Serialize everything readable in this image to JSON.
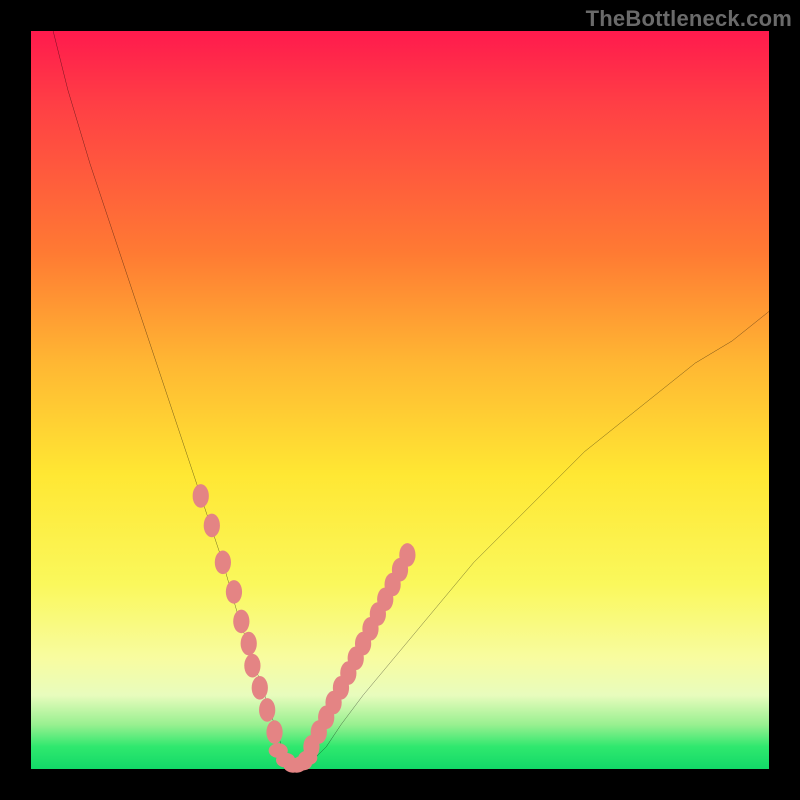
{
  "watermark": "TheBottleneck.com",
  "chart_data": {
    "type": "line",
    "title": "",
    "xlabel": "",
    "ylabel": "",
    "xlim": [
      0,
      100
    ],
    "ylim": [
      0,
      100
    ],
    "grid": false,
    "series": [
      {
        "name": "bottleneck-curve",
        "x": [
          3,
          5,
          8,
          11,
          14,
          17,
          20,
          23,
          26,
          28,
          30,
          32,
          33,
          34,
          35,
          36,
          38,
          40,
          42,
          45,
          50,
          55,
          60,
          65,
          70,
          75,
          80,
          85,
          90,
          95,
          100
        ],
        "y": [
          100,
          92,
          82,
          73,
          64,
          55,
          46,
          37,
          28,
          21,
          15,
          9,
          6,
          3,
          1,
          0,
          1,
          3,
          6,
          10,
          16,
          22,
          28,
          33,
          38,
          43,
          47,
          51,
          55,
          58,
          62
        ]
      }
    ],
    "markers": {
      "name": "highlighted-points",
      "color": "#e48484",
      "left_branch": {
        "x": [
          23,
          24.5,
          26,
          27.5,
          28.5,
          29.5,
          30,
          31,
          32,
          33
        ],
        "y": [
          37,
          33,
          28,
          24,
          20,
          17,
          14,
          11,
          8,
          5
        ]
      },
      "valley": {
        "x": [
          33.5,
          34.5,
          35.5,
          36,
          36.8,
          37.5
        ],
        "y": [
          2.5,
          1.2,
          0.5,
          0.5,
          0.8,
          1.5
        ]
      },
      "right_branch": {
        "x": [
          38,
          39,
          40,
          41,
          42,
          43,
          44,
          45,
          46,
          47,
          48,
          49,
          50,
          51
        ],
        "y": [
          3,
          5,
          7,
          9,
          11,
          13,
          15,
          17,
          19,
          21,
          23,
          25,
          27,
          29
        ]
      }
    },
    "gradient_stops": [
      {
        "pos": 0,
        "color": "#ff1a4d"
      },
      {
        "pos": 30,
        "color": "#ff7a33"
      },
      {
        "pos": 60,
        "color": "#ffe733"
      },
      {
        "pos": 85,
        "color": "#f8fca0"
      },
      {
        "pos": 97,
        "color": "#2fe86e"
      },
      {
        "pos": 100,
        "color": "#12d968"
      }
    ]
  }
}
